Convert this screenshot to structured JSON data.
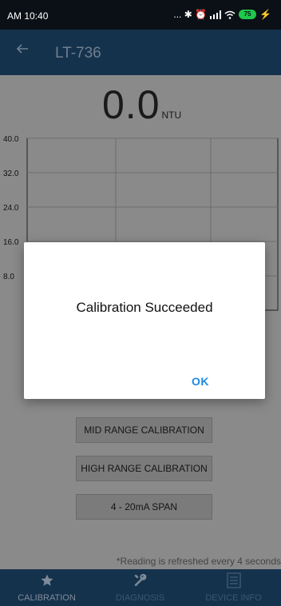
{
  "status_bar": {
    "time": "AM 10:40",
    "icons_text": "... ✱ ⏰",
    "battery": "75"
  },
  "app_bar": {
    "back_icon": "back-arrow-icon",
    "title": "LT-736"
  },
  "reading": {
    "value": "0.0",
    "unit": "NTU"
  },
  "chart_data": {
    "type": "line",
    "title": "",
    "xlabel": "",
    "ylabel": "",
    "y_ticks": [
      "40.0",
      "32.0",
      "24.0",
      "16.0",
      "8.0"
    ],
    "ylim": [
      0,
      40
    ],
    "grid": true,
    "series": [
      {
        "values": []
      }
    ]
  },
  "buttons": {
    "mid_range": "MID RANGE CALIBRATION",
    "high_range": "HIGH RANGE CALIBRATION",
    "span": "4 - 20mA SPAN"
  },
  "refresh_note": "*Reading is refreshed every 4 seconds",
  "bottom_nav": {
    "items": [
      {
        "label": "CALIBRATION",
        "icon": "star-icon",
        "active": true
      },
      {
        "label": "DIAGNOSIS",
        "icon": "tools-icon",
        "active": false
      },
      {
        "label": "DEVICE INFO",
        "icon": "document-icon",
        "active": false
      }
    ]
  },
  "dialog": {
    "message": "Calibration Succeeded",
    "ok_label": "OK"
  },
  "colors": {
    "app_bar": "#15324d",
    "dialog_button": "#1e88e5",
    "battery": "#1ec84b"
  }
}
